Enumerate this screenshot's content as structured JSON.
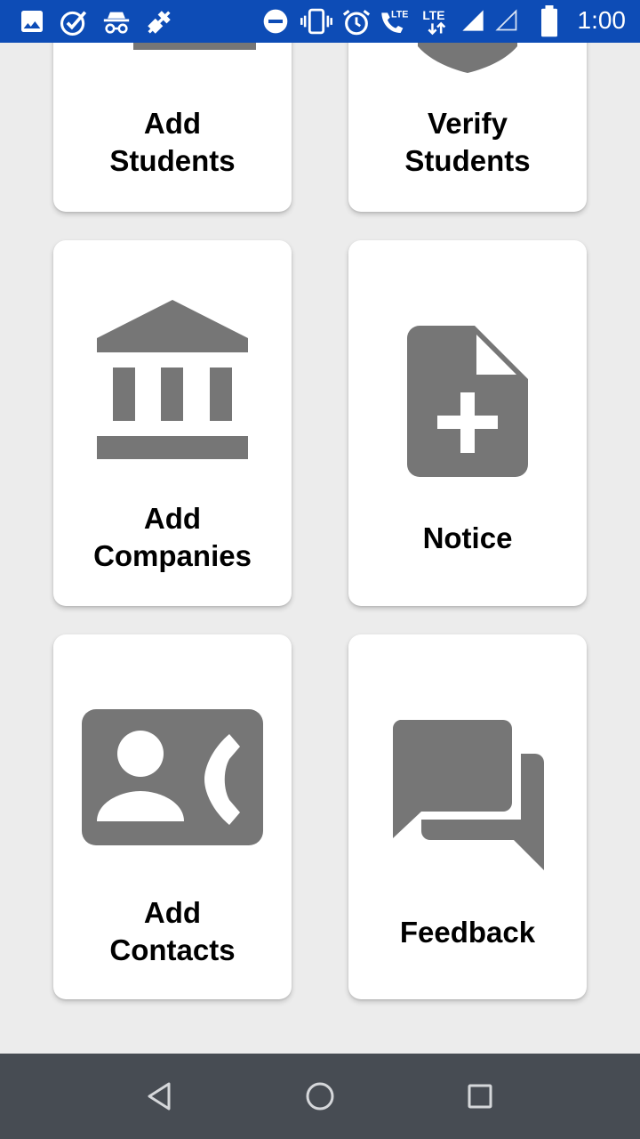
{
  "status_bar": {
    "time": "1:00",
    "lte_label_1": "LTE",
    "lte_label_2": "LTE",
    "icons": [
      "image-icon",
      "check-circle-icon",
      "incognito-icon",
      "mic-off-icon",
      "do-not-disturb-icon",
      "vibrate-icon",
      "alarm-icon",
      "wifi-calling-icon",
      "lte-data-icon",
      "signal-full-icon",
      "signal-empty-icon",
      "battery-icon"
    ]
  },
  "cards": [
    {
      "id": "add-students",
      "label": "Add\nStudents",
      "icon": "add-student-icon"
    },
    {
      "id": "verify-students",
      "label": "Verify\nStudents",
      "icon": "shield-icon"
    },
    {
      "id": "add-companies",
      "label": "Add\nCompanies",
      "icon": "bank-icon"
    },
    {
      "id": "notice",
      "label": "Notice",
      "icon": "note-add-icon"
    },
    {
      "id": "add-contacts",
      "label": "Add\nContacts",
      "icon": "contact-phone-icon"
    },
    {
      "id": "feedback",
      "label": "Feedback",
      "icon": "forum-icon"
    }
  ],
  "colors": {
    "status_bar": "#0d4cb6",
    "background": "#ececec",
    "card": "#ffffff",
    "icon": "#767676",
    "nav_bar": "#474c53"
  },
  "nav": [
    "back-icon",
    "home-icon",
    "recents-icon"
  ]
}
